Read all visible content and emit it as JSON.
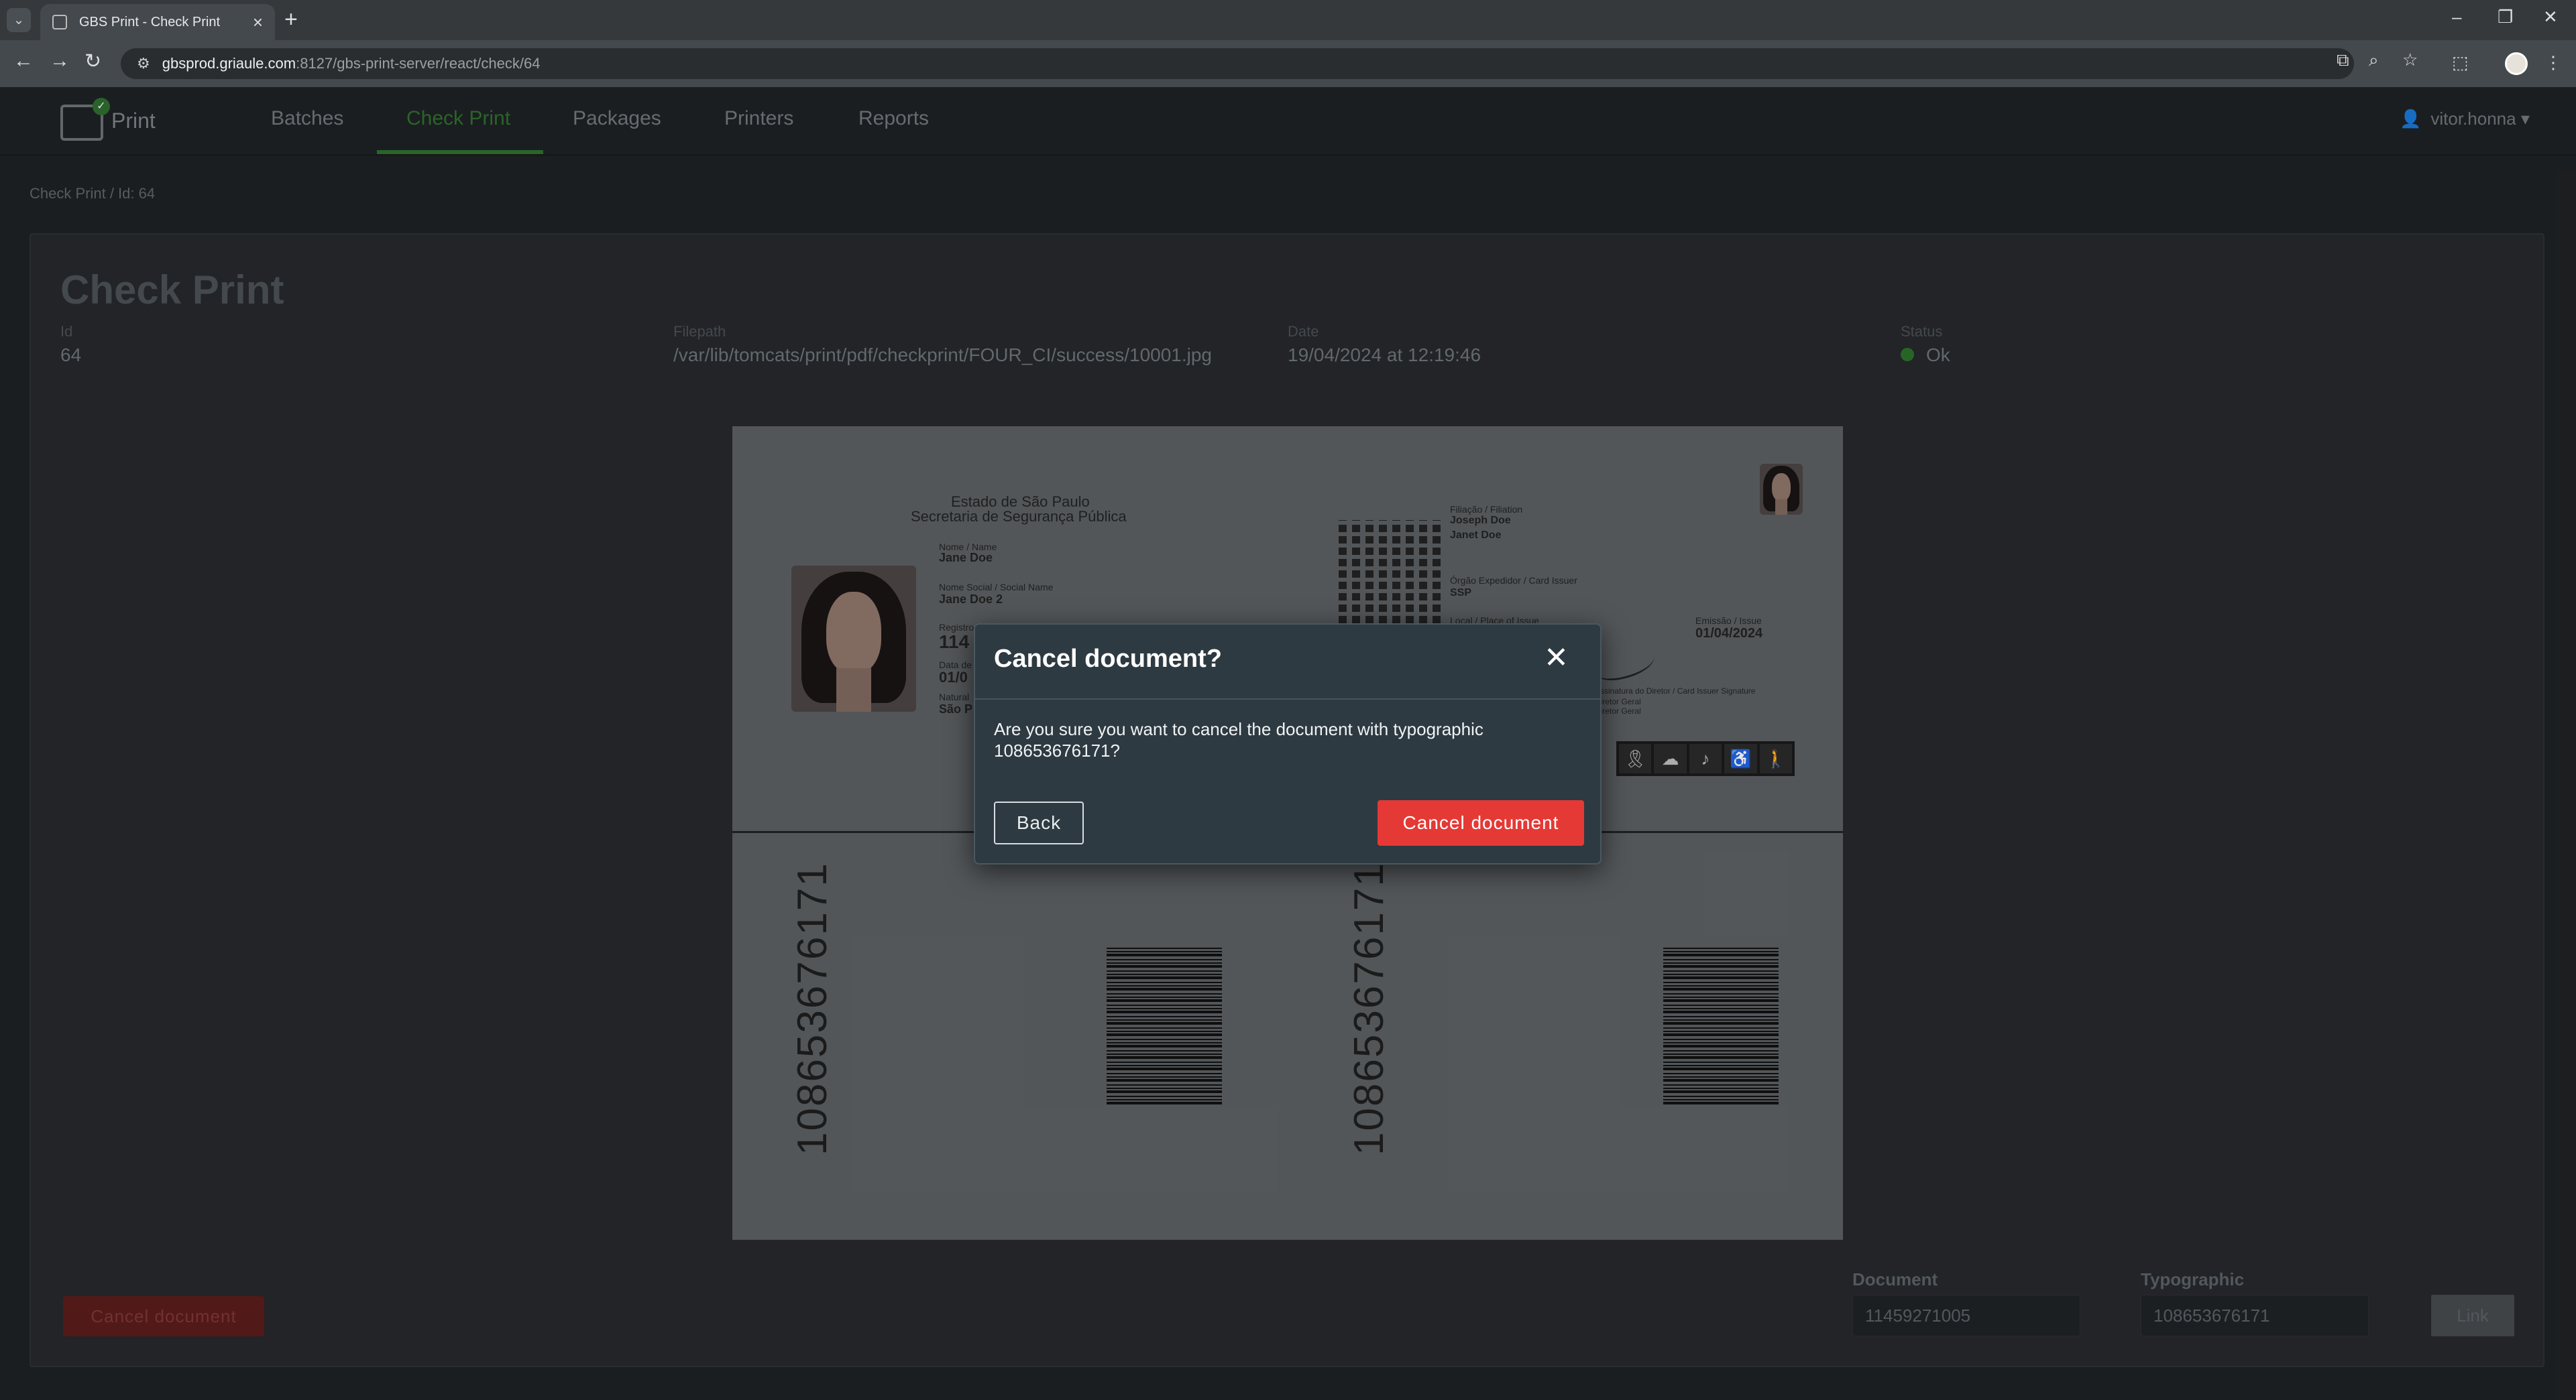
{
  "browser": {
    "tab_title": "GBS Print - Check Print",
    "new_tab_symbol": "+",
    "url_host": "gbsprod.griaule.com",
    "url_path": ":8127/gbs-print-server/react/check/64"
  },
  "header": {
    "logo_text": "Print",
    "nav": [
      "Batches",
      "Check Print",
      "Packages",
      "Printers",
      "Reports"
    ],
    "active_nav": "Check Print",
    "user": "vitor.honna"
  },
  "breadcrumb": "Check Print / Id: 64",
  "page": {
    "title": "Check Print",
    "fields": {
      "id_label": "Id",
      "id_value": "64",
      "filepath_label": "Filepath",
      "filepath_value": "/var/lib/tomcats/print/pdf/checkprint/FOUR_CI/success/10001.jpg",
      "date_label": "Date",
      "date_value": "19/04/2024 at 12:19:46",
      "status_label": "Status",
      "status_value": "Ok",
      "status_color": "#2b6e2b"
    }
  },
  "preview": {
    "state": "Estado de São Paulo",
    "department": "Secretaria de Segurança Pública",
    "name_label": "Nome / Name",
    "name_value": "Jane Doe",
    "social_label": "Nome Social / Social Name",
    "social_value": "Jane Doe 2",
    "reg_label": "Registro",
    "reg_value": "114",
    "dob_label": "Data de",
    "dob_value": "01/0",
    "place_label": "Natural",
    "place_value": "São P",
    "filiation_label": "Filiação / Filiation",
    "father": "Joseph Doe",
    "mother": "Janet Doe",
    "issuer_label": "Órgão Expedidor / Card Issuer",
    "issuer_value": "SSP",
    "place_issue_label": "Local / Place of Issue",
    "emission_label": "Emissão / Issue",
    "emission_value": "01/04/2024",
    "signature_label": "Assinatura do Diretor / Card Issuer Signature",
    "director_label": "Diretor Geral",
    "director_sub": "Diretor Geral",
    "typographic_number": "108653676171"
  },
  "bottom": {
    "cancel_label": "Cancel document",
    "document_label": "Document",
    "document_value": "11459271005",
    "typographic_label": "Typographic",
    "typographic_value": "108653676171",
    "link_label": "Link"
  },
  "modal": {
    "title": "Cancel document?",
    "body": "Are you sure you want to cancel the document with typographic 108653676171?",
    "back_label": "Back",
    "confirm_label": "Cancel document",
    "confirm_color": "#e53935"
  }
}
